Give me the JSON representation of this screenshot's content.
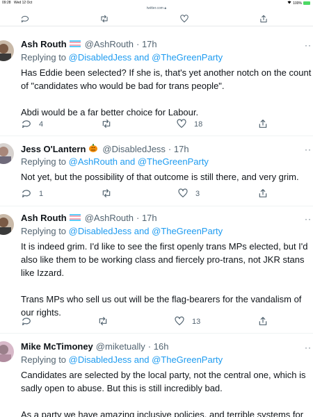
{
  "status_bar": {
    "time": "09:28",
    "date": "Wed 12 Oct",
    "battery": "100%"
  },
  "browser": {
    "url": "twitter.com"
  },
  "tweets": [
    {
      "name": "Ash Routh",
      "handle": "@AshRouth",
      "time": "· 17h",
      "replying_prefix": "Replying to ",
      "replying_to": "@DisabledJess and @TheGreenParty",
      "body": "Has Eddie been selected? If she is, that's yet another notch on the count of \"candidates who would be bad for trans people\".\n\nAbdi would be a far better choice for Labour.",
      "replies": "4",
      "retweets": "",
      "likes": "18"
    },
    {
      "name": "Jess O'Lantern",
      "handle": "@DisabledJess",
      "time": "· 17h",
      "replying_prefix": "Replying to ",
      "replying_to": "@AshRouth and @TheGreenParty",
      "body": "Not yet, but the possibility of that outcome is still there, and very grim.",
      "replies": "1",
      "retweets": "",
      "likes": "3"
    },
    {
      "name": "Ash Routh",
      "handle": "@AshRouth",
      "time": "· 17h",
      "replying_prefix": "Replying to ",
      "replying_to": "@DisabledJess and @TheGreenParty",
      "body": "It is indeed grim. I'd like to see the first openly trans MPs elected, but I'd also like them to be working class and fiercely pro-trans, not JKR stans like Izzard.\n\nTrans MPs who sell us out will be the flag-bearers for the vandalism of our rights.",
      "replies": "",
      "retweets": "",
      "likes": "13"
    },
    {
      "name": "Mike McTimoney",
      "handle": "@miketually",
      "time": "· 16h",
      "replying_prefix": "Replying to ",
      "replying_to": "@DisabledJess and @TheGreenParty",
      "body": "Candidates are selected by the local party, not the central one, which is sadly open to abuse. But this is still incredibly bad.\n\nAs a party we have amazing inclusive policies, and terrible systems for dealing with transphobes."
    }
  ],
  "colors": {
    "link": "#1d9bf0",
    "muted": "#536471",
    "text": "#0f1419"
  }
}
